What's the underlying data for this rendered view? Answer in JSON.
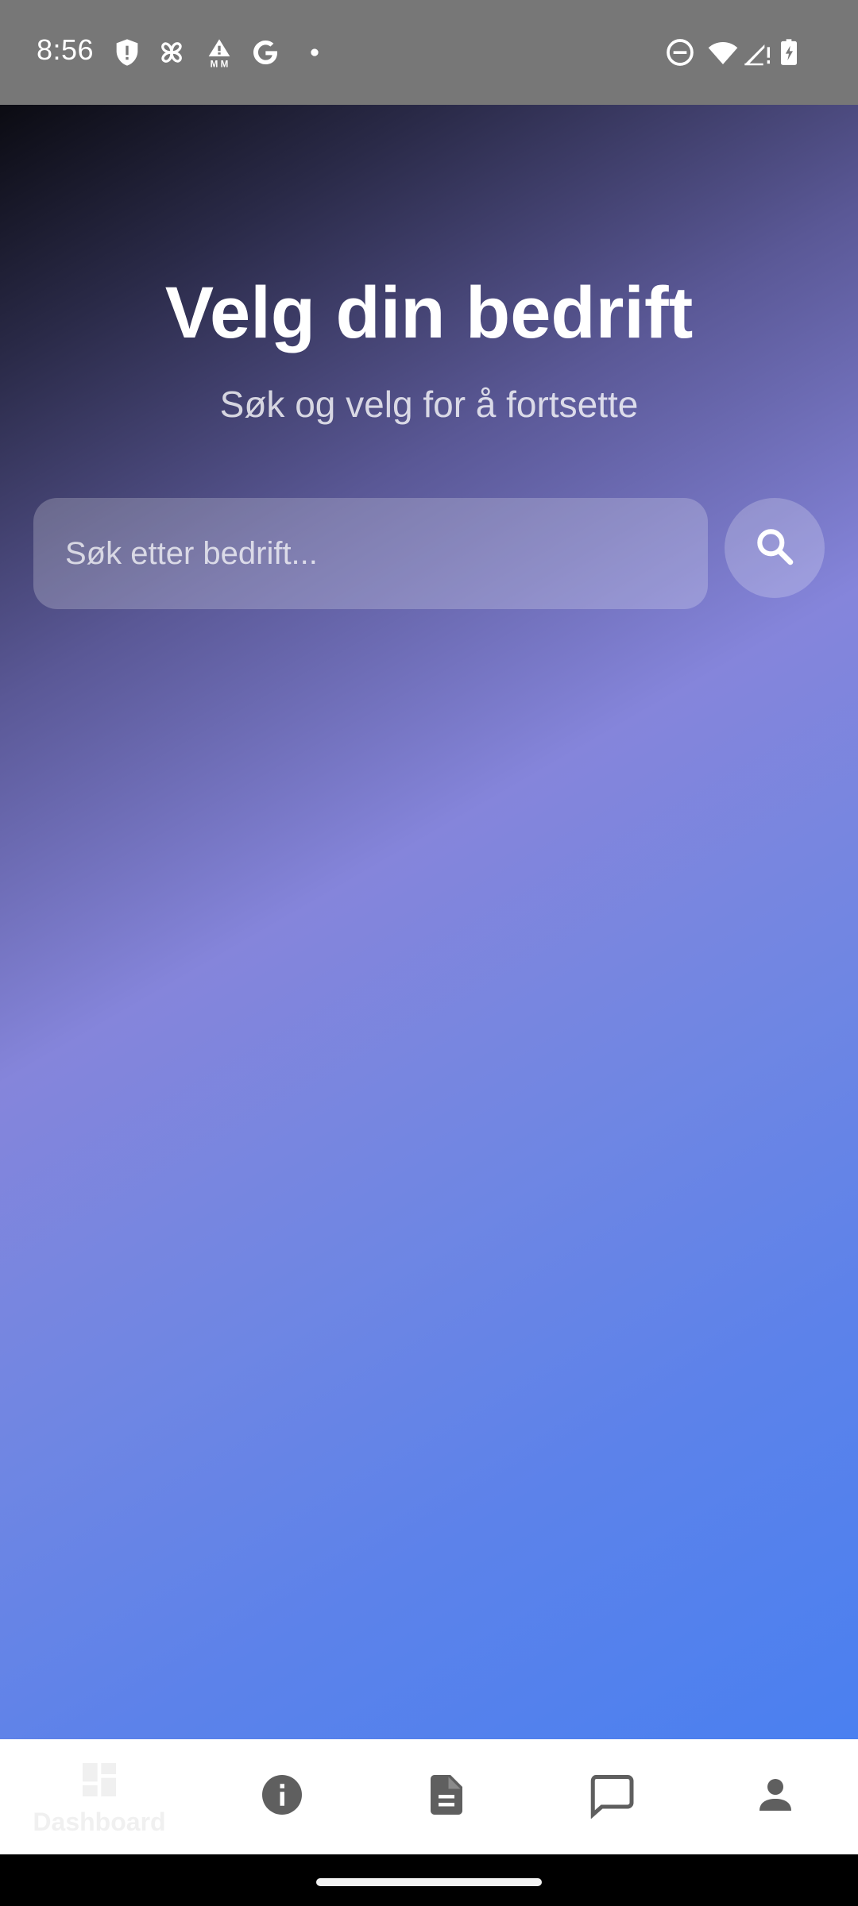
{
  "status_bar": {
    "time": "8:56",
    "left_icons": [
      "shield-alert-icon",
      "pinwheel-icon",
      "mm-warning-icon",
      "google-icon",
      "dot-icon"
    ],
    "right_icons": [
      "do-not-disturb-icon",
      "wifi-icon",
      "signal-no-service-icon",
      "battery-charging-icon"
    ]
  },
  "header": {
    "title": "Velg din bedrift",
    "subtitle": "Søk og velg for å fortsette"
  },
  "search": {
    "placeholder": "Søk etter bedrift...",
    "value": "",
    "button_icon": "search-icon"
  },
  "bottom_nav": {
    "items": [
      {
        "icon": "dashboard-icon",
        "label": "Dashboard"
      },
      {
        "icon": "info-icon",
        "label": ""
      },
      {
        "icon": "document-icon",
        "label": ""
      },
      {
        "icon": "chat-icon",
        "label": ""
      },
      {
        "icon": "person-icon",
        "label": ""
      }
    ]
  },
  "colors": {
    "status_bar_bg": "#777777",
    "gradient_top": "#0b0b12",
    "gradient_mid": "#8585db",
    "gradient_bottom": "#4a80f0",
    "nav_icon": "#5f5f5f",
    "nav_inactive": "#f0f0f0"
  }
}
